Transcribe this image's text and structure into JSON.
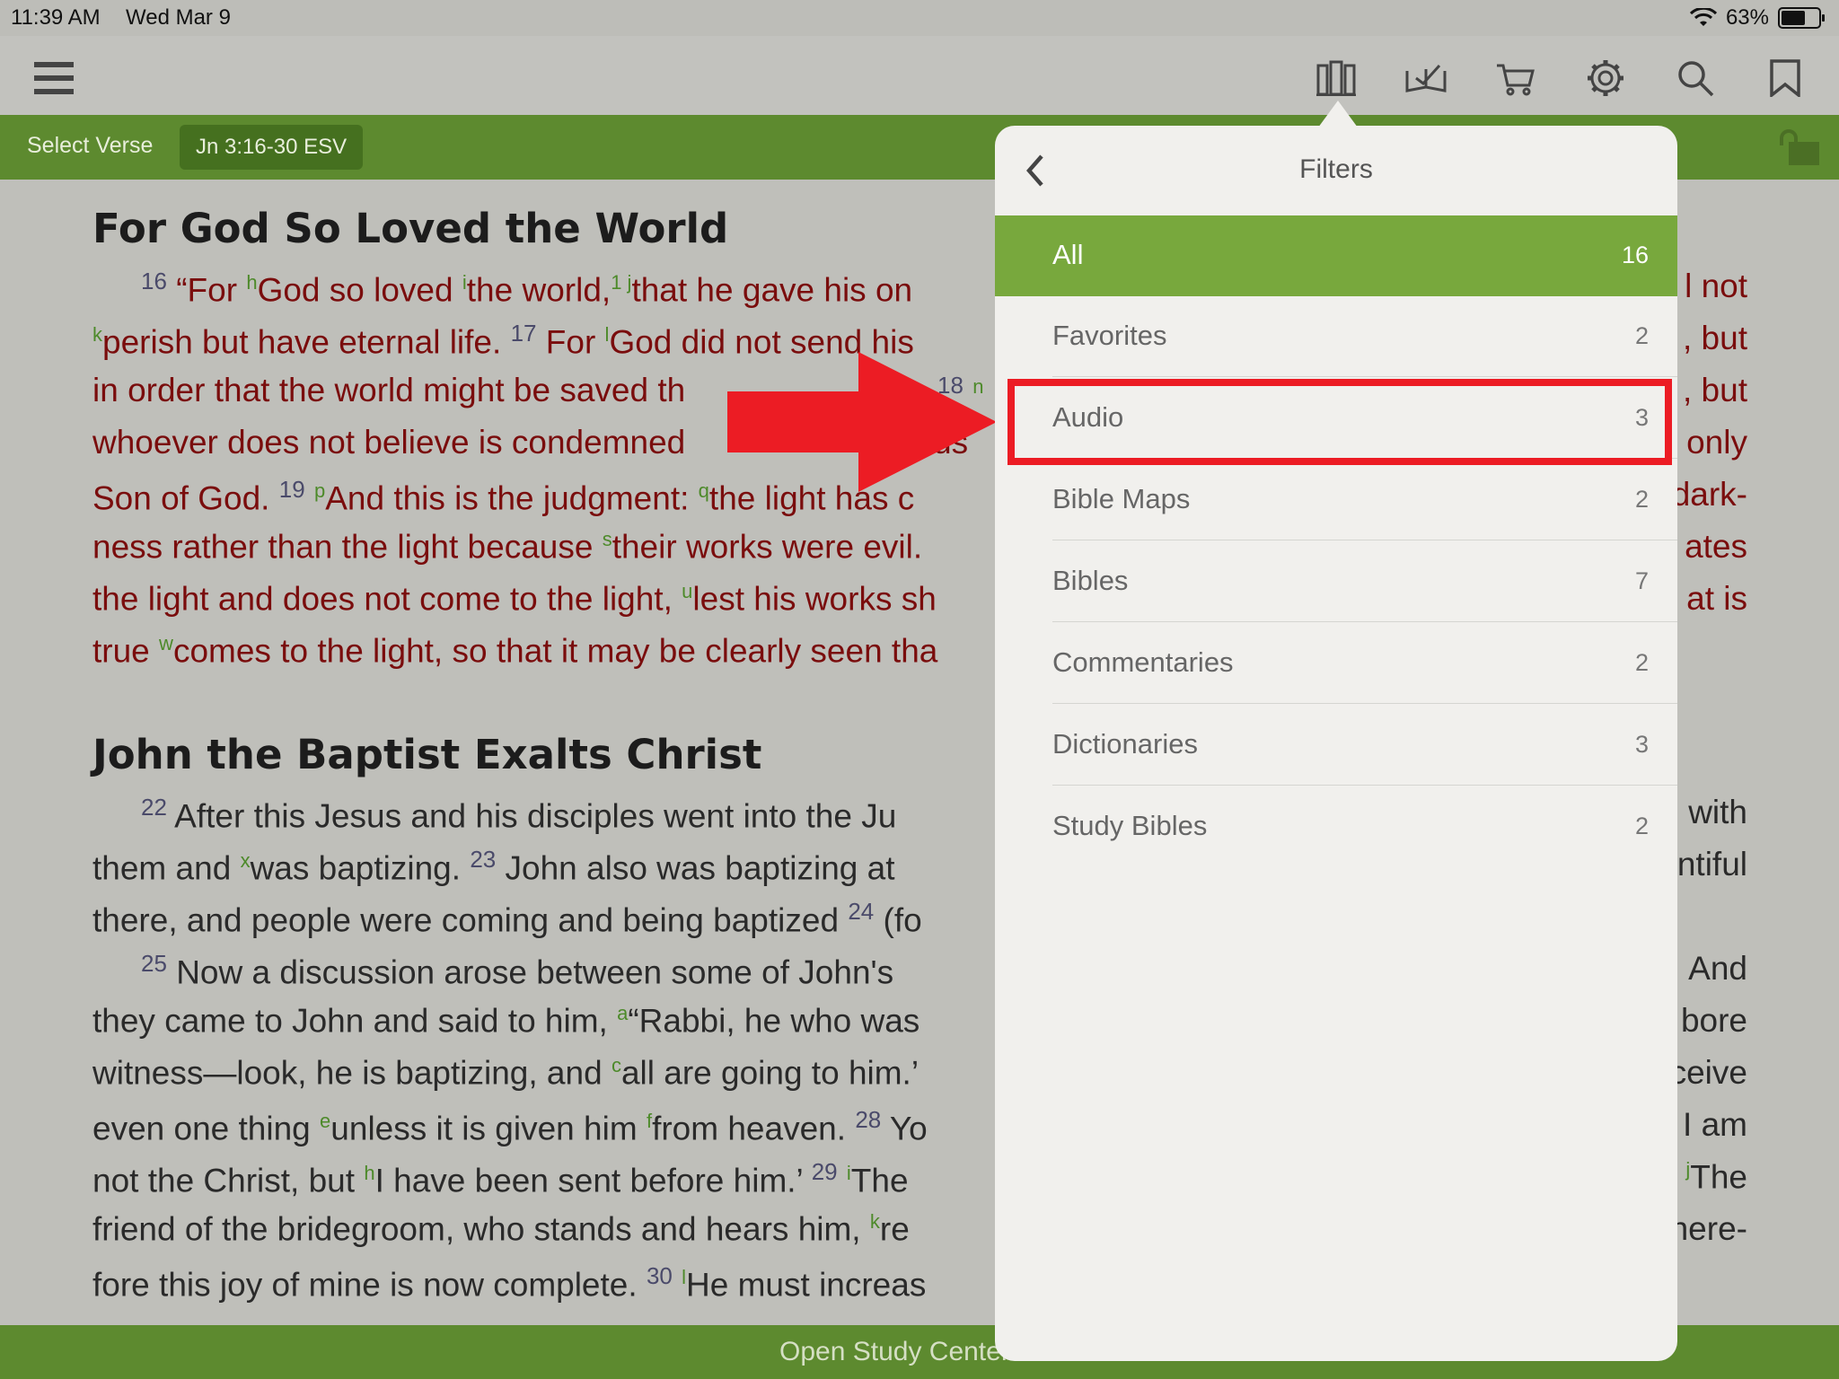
{
  "status": {
    "time": "11:39 AM",
    "date": "Wed Mar 9",
    "battery": "63%"
  },
  "toolbar": {
    "icons": [
      "menu-icon",
      "library-icon",
      "reading-plan-icon",
      "cart-icon",
      "gear-icon",
      "search-icon",
      "bookmark-icon"
    ]
  },
  "verse_bar": {
    "select_label": "Select Verse",
    "reference": "Jn 3:16-30 ESV"
  },
  "passage": {
    "heading1": "For God So Loved the World",
    "heading2": "John the Baptist Exalts Christ",
    "lines": [
      [
        "16",
        " “For ",
        "h",
        "God so loved ",
        "i",
        "the world,",
        "1 j",
        "that he gave his on"
      ],
      [
        "k",
        "perish but have eternal life.  ",
        "17",
        " For ",
        "l",
        "God did not send his"
      ],
      [
        "in order that the world might be saved th"
      ],
      [
        "whoever does not believe is condemned"
      ],
      [
        "Son of God.  ",
        "19",
        " ",
        "p",
        "And this is the judgment: ",
        "q",
        "the light has c"
      ],
      [
        "ness rather than the light because ",
        "s",
        "their works were evil."
      ],
      [
        "the light and does not come to the light, ",
        "u",
        "lest his works sh"
      ],
      [
        "true ",
        "w",
        "comes to the light, so that it may be clearly seen tha"
      ]
    ],
    "lines2": [
      [
        "22",
        " After this Jesus and his disciples went into the Ju"
      ],
      [
        "them and ",
        "x",
        "was baptizing.  ",
        "23",
        " John also was baptizing at"
      ],
      [
        "there, and people were coming and being baptized  ",
        "24",
        " (fo"
      ],
      [
        "25",
        " Now a discussion arose between some of John's"
      ],
      [
        "they came to John and said to him, ",
        "a",
        "“Rabbi, he who was"
      ],
      [
        "witness—look, he is baptizing, and ",
        "c",
        "all are going to him.’"
      ],
      [
        "even one thing ",
        "e",
        "unless it is given him ",
        "f",
        "from heaven.  ",
        "28",
        " Yo"
      ],
      [
        "not the Christ, but ",
        "h",
        "I have been sent before him.’  ",
        "29",
        " ",
        "i",
        "The"
      ],
      [
        "friend of the bridegroom, who stands and hears him, ",
        "k",
        "re"
      ],
      [
        "fore this joy of mine is now complete.  ",
        "30",
        " ",
        "l",
        "He must increas"
      ]
    ],
    "right1": [
      "l not",
      ", but",
      ", but",
      "only",
      "dark-",
      "ates",
      "at is"
    ],
    "right2": [
      "with",
      "ntiful",
      "And",
      "bore",
      "ceive",
      "I am",
      "The",
      "here-"
    ],
    "partial_18": "18",
    "partial_n": "n",
    "partial_j": "j",
    "partial_caus": "caus"
  },
  "bottom": {
    "label": "Open Study Center"
  },
  "filters": {
    "title": "Filters",
    "items": [
      {
        "label": "All",
        "count": "16",
        "active": true
      },
      {
        "label": "Favorites",
        "count": "2"
      },
      {
        "label": "Audio",
        "count": "3"
      },
      {
        "label": "Bible Maps",
        "count": "2"
      },
      {
        "label": "Bibles",
        "count": "7"
      },
      {
        "label": "Commentaries",
        "count": "2"
      },
      {
        "label": "Dictionaries",
        "count": "3"
      },
      {
        "label": "Study Bibles",
        "count": "2"
      }
    ]
  },
  "annotation": {
    "arrow_color": "#ec1c24",
    "highlight_color": "#ec1c24"
  }
}
